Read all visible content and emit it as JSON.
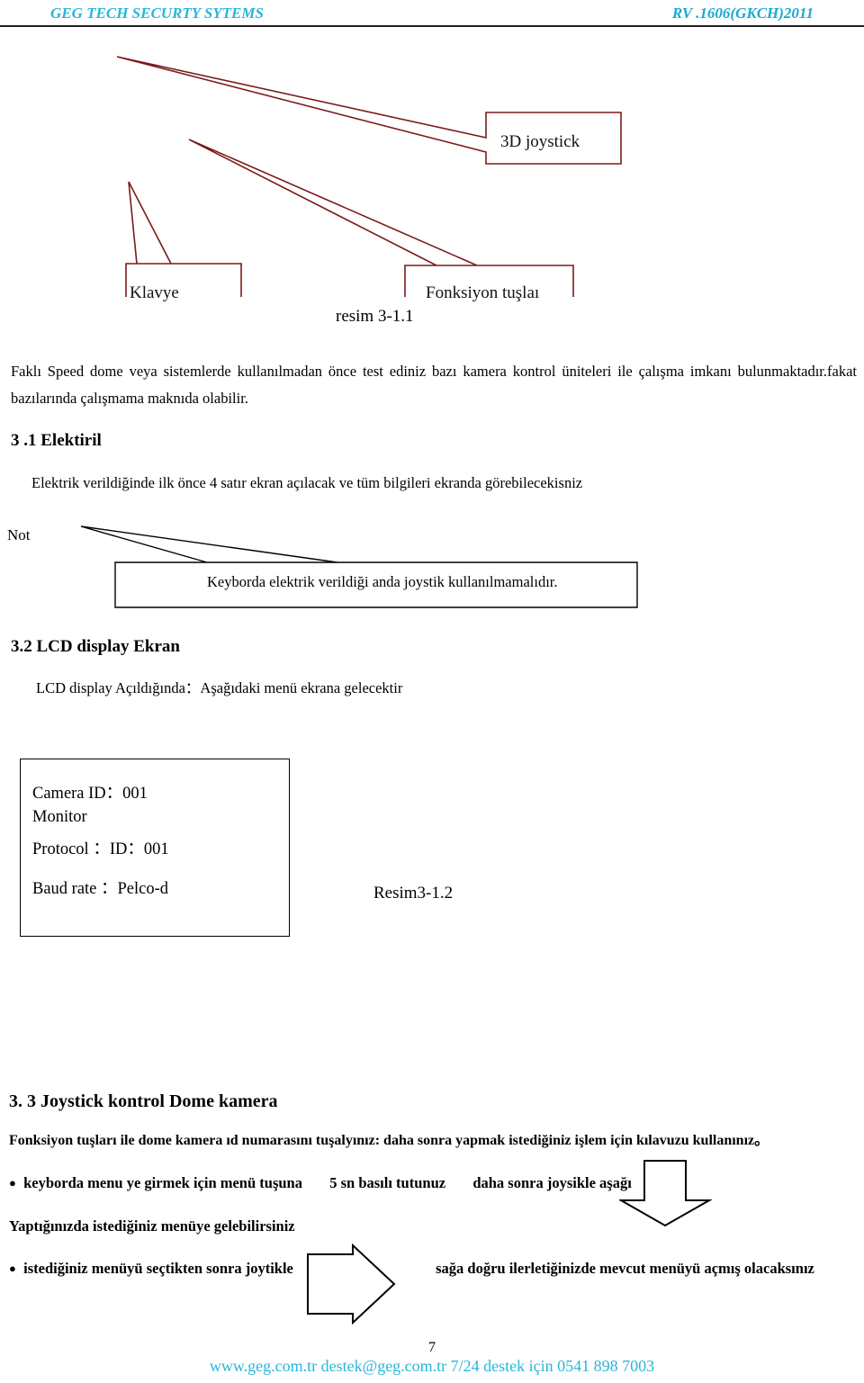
{
  "header": {
    "left_title": "GEG TECH SECURTY SYTEMS",
    "right_code": "RV .1606(GKCH)2011",
    "accent_color": "#29b6d8"
  },
  "diagram": {
    "callout_color": "#7b1a1a",
    "callouts": [
      {
        "label": "3D joystick"
      },
      {
        "label": "Klavye"
      },
      {
        "label": "Fonksiyon tuşlaı"
      }
    ],
    "caption": "resim 3-1.1"
  },
  "intro": {
    "paragraph": "Faklı Speed dome veya sistemlerde kullanılmadan önce test ediniz bazı   kamera kontrol üniteleri ile çalışma imkanı bulunmaktadır.fakat bazılarında çalışmama maknıda olabilir."
  },
  "section_31": {
    "heading": "3 .1 Elektiril",
    "body": "Elektrik verildiğinde ilk önce 4 satır ekran açılacak ve tüm bilgileri ekranda görebilecekisniz",
    "note_label": "Not",
    "note_text": "Keyborda elektrik verildiği anda joystik kullanılmamalıdır."
  },
  "section_32": {
    "heading": "3.2 LCD display Ekran",
    "body": "LCD display Açıldığında：Aşağıdaki menü ekrana gelecektir",
    "lcd_screen": {
      "line1": "Camera        ID：001",
      "line2": "Monitor",
      "line3": "Protocol    ：ID：001",
      "line4": "Baud rate  ：Pelco-d"
    },
    "caption": "Resim3-1.2"
  },
  "section_33": {
    "heading": "3. 3 Joystick kontrol    Dome kamera",
    "body": "Fonksiyon tuşları ile dome kamera ıd numarasını tuşalyınız: daha sonra yapmak istediğiniz işlem için kılavuzu kullanınız。",
    "bullet1": {
      "part1": "keyborda menu ye girmek için menü tuşuna",
      "part2": "5 sn basılı tutunuz",
      "part3": "daha sonra joysikle aşağı"
    },
    "continuation": "Yaptığınızda istediğiniz menüye gelebilirsiniz",
    "bullet2": {
      "part1": "istediğiniz menüyü seçtikten sonra joytikle",
      "part2": "sağa doğru ilerletiğinizde mevcut menüyü açmış olacaksınız"
    }
  },
  "footer": {
    "page_number": "7",
    "contact": "www.geg.com.tr   destek@geg.com.tr 7/24 destek için   0541 898 7003"
  }
}
